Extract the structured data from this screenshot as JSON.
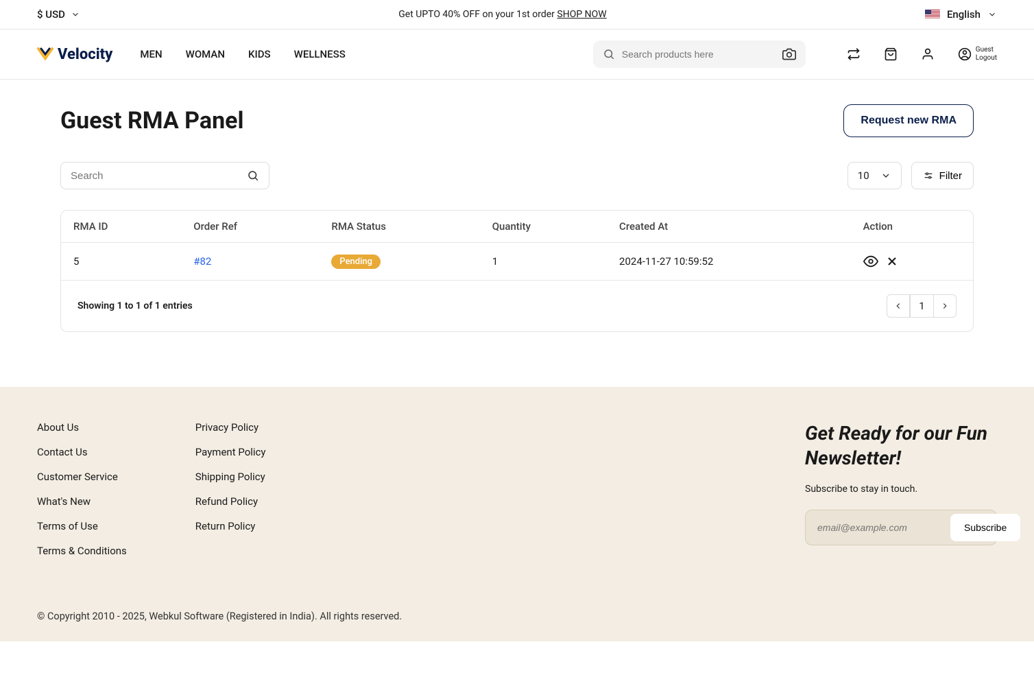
{
  "topbar": {
    "currency": "$ USD",
    "promo_prefix": "Get UPTO 40% OFF on your 1st order ",
    "promo_cta": "SHOP NOW",
    "language": "English"
  },
  "header": {
    "logo": "Velocity",
    "nav": [
      "MEN",
      "WOMAN",
      "KIDS",
      "WELLNESS"
    ],
    "search_placeholder": "Search products here",
    "guest_label": "Guest",
    "logout_label": "Logout"
  },
  "main": {
    "title": "Guest RMA Panel",
    "request_btn": "Request new RMA",
    "search_placeholder": "Search",
    "per_page": "10",
    "filter_label": "Filter",
    "columns": [
      "RMA ID",
      "Order Ref",
      "RMA Status",
      "Quantity",
      "Created At",
      "Action"
    ],
    "rows": [
      {
        "rma_id": "5",
        "order_ref": "#82",
        "status": "Pending",
        "quantity": "1",
        "created_at": "2024-11-27 10:59:52"
      }
    ],
    "entries_text": "Showing 1 to 1 of 1 entries",
    "current_page": "1"
  },
  "footer": {
    "col1": [
      "About Us",
      "Contact Us",
      "Customer Service",
      "What's New",
      "Terms of Use",
      "Terms & Conditions"
    ],
    "col2": [
      "Privacy Policy",
      "Payment Policy",
      "Shipping Policy",
      "Refund Policy",
      "Return Policy"
    ],
    "newsletter_title": "Get Ready for our Fun Newsletter!",
    "newsletter_sub": "Subscribe to stay in touch.",
    "newsletter_placeholder": "email@example.com",
    "subscribe_btn": "Subscribe",
    "copyright": "© Copyright 2010 - 2025, Webkul Software (Registered in India). All rights reserved."
  }
}
